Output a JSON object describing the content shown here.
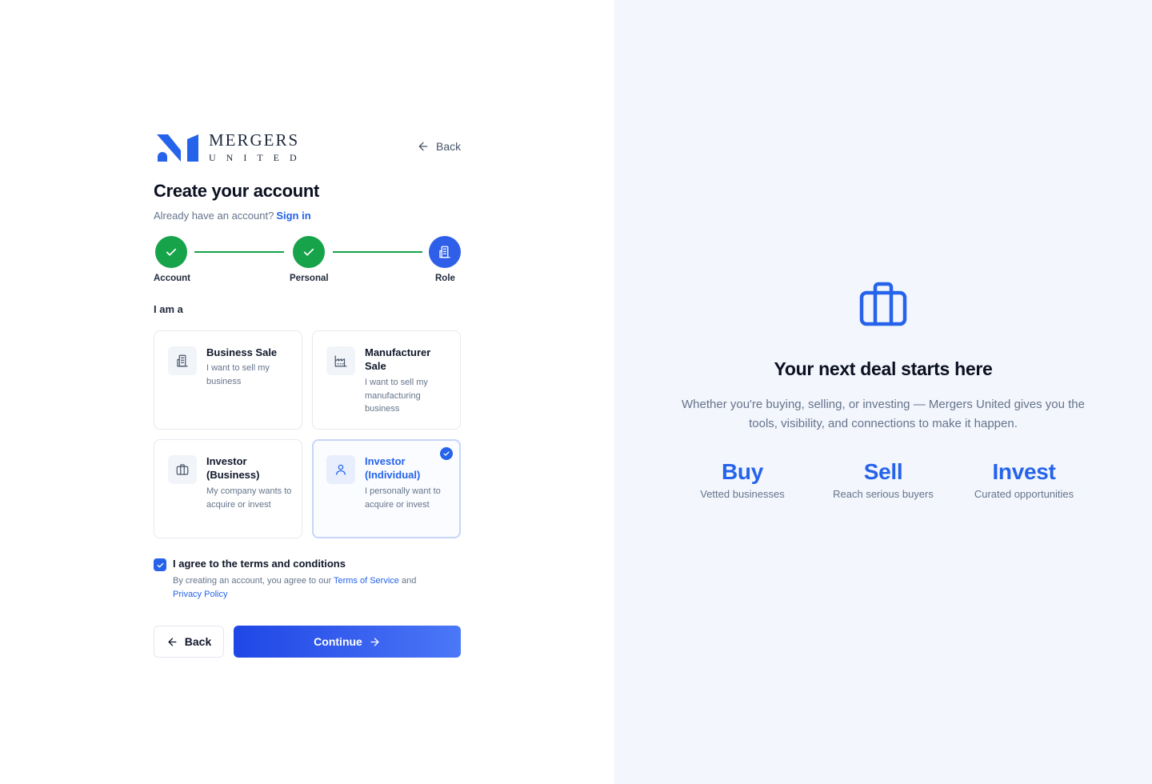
{
  "brand": {
    "line1": "MERGERS",
    "line2": "UNITED",
    "accent": "#2563eb"
  },
  "header": {
    "back_label": "Back"
  },
  "form": {
    "title": "Create your account",
    "subtitle_prefix": "Already have an account?",
    "signin_label": "Sign in"
  },
  "stepper": {
    "steps": [
      {
        "label": "Account",
        "state": "done",
        "icon": "check-icon"
      },
      {
        "label": "Personal",
        "state": "done",
        "icon": "check-icon"
      },
      {
        "label": "Role",
        "state": "active",
        "icon": "building-icon"
      }
    ],
    "done_color": "#16a34a",
    "active_color": "#2f5fe8"
  },
  "roles": {
    "prompt": "I am a",
    "options": [
      {
        "title": "Business Sale",
        "description": "I want to sell my business",
        "icon": "building-icon",
        "selected": false
      },
      {
        "title": "Manufacturer Sale",
        "description": "I want to sell my manufacturing business",
        "icon": "factory-icon",
        "selected": false
      },
      {
        "title": "Investor (Business)",
        "description": "My company wants to acquire or invest",
        "icon": "briefcase-icon",
        "selected": false
      },
      {
        "title": "Investor (Individual)",
        "description": "I personally want to acquire or invest",
        "icon": "user-icon",
        "selected": true
      }
    ]
  },
  "terms": {
    "checked": true,
    "label": "I agree to the terms and conditions",
    "note_prefix": "By creating an account, you agree to our",
    "tos_link": "Terms of Service",
    "and": "and",
    "privacy_link": "Privacy Policy"
  },
  "actions": {
    "back_label": "Back",
    "continue_label": "Continue"
  },
  "promo": {
    "icon": "briefcase-icon",
    "title": "Your next deal starts here",
    "description": "Whether you're buying, selling, or investing — Mergers United gives you the tools, visibility, and connections to make it happen.",
    "stats": [
      {
        "value": "Buy",
        "label": "Vetted businesses"
      },
      {
        "value": "Sell",
        "label": "Reach serious buyers"
      },
      {
        "value": "Invest",
        "label": "Curated opportunities"
      }
    ]
  }
}
